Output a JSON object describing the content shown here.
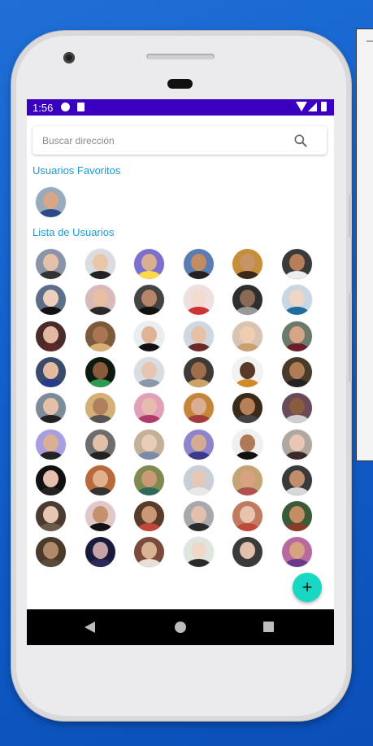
{
  "status_bar": {
    "time": "1:56"
  },
  "search": {
    "placeholder": "Buscar dirección",
    "value": "",
    "icon": "search-icon"
  },
  "favorites": {
    "title": "Usuarios Favoritos",
    "users": [
      {
        "skin": "#d8a787",
        "bg": "#9ab",
        "shirt": "#2b4a8a"
      }
    ]
  },
  "users_list": {
    "title": "Lista de Usuarios",
    "users": [
      {
        "skin": "#e4c2a8",
        "bg": "#8a94a6",
        "shirt": "#333"
      },
      {
        "skin": "#e8c6a6",
        "bg": "#d9dde2",
        "shirt": "#222"
      },
      {
        "skin": "#d9b08f",
        "bg": "#7b6fd0",
        "shirt": "#ffd84a"
      },
      {
        "skin": "#c58d5f",
        "bg": "#5b7cb0",
        "shirt": "#222"
      },
      {
        "skin": "#c79468",
        "bg": "#c48e3a",
        "shirt": "#3a2a1a"
      },
      {
        "skin": "#b57f59",
        "bg": "#3a3a3a",
        "shirt": "#eee"
      },
      {
        "skin": "#ecd0bd",
        "bg": "#5c6f86",
        "shirt": "#111"
      },
      {
        "skin": "#e7bfa3",
        "bg": "#d9b9b9",
        "shirt": "#2a2a2a"
      },
      {
        "skin": "#b5866a",
        "bg": "#444",
        "shirt": "#111"
      },
      {
        "skin": "#f2dccf",
        "bg": "#efe0e0",
        "shirt": "#c33"
      },
      {
        "skin": "#8a6a55",
        "bg": "#2e2e2e",
        "shirt": "#999"
      },
      {
        "skin": "#f0d6c6",
        "bg": "#c9d6e3",
        "shirt": "#1e6d9c"
      },
      {
        "skin": "#e2b8a0",
        "bg": "#4b2a2a",
        "shirt": "#5a2a2a"
      },
      {
        "skin": "#a97552",
        "bg": "#7c5a3c",
        "shirt": "#d6b070"
      },
      {
        "skin": "#e0b296",
        "bg": "#e9eef1",
        "shirt": "#111"
      },
      {
        "skin": "#e6c1a6",
        "bg": "#cfd8e0",
        "shirt": "#6b2a2a"
      },
      {
        "skin": "#f0cdb0",
        "bg": "#d8c4b0",
        "shirt": "#c9a070"
      },
      {
        "skin": "#d6a486",
        "bg": "#6b7a6a",
        "shirt": "#6a1f2a"
      },
      {
        "skin": "#e2bba1",
        "bg": "#3a4a6a",
        "shirt": "#2a3a8a"
      },
      {
        "skin": "#8b5a3c",
        "bg": "#0c1a10",
        "shirt": "#2e9a52"
      },
      {
        "skin": "#e6c6b2",
        "bg": "#d8dde2",
        "shirt": "#8a97a8"
      },
      {
        "skin": "#a06e4b",
        "bg": "#3f3a36",
        "shirt": "#c9a36a"
      },
      {
        "skin": "#5a3a28",
        "bg": "#f2f2f2",
        "shirt": "#d08a2a"
      },
      {
        "skin": "#b07c56",
        "bg": "#4a3a2a",
        "shirt": "#222"
      },
      {
        "skin": "#e4c0a8",
        "bg": "#7c8c9a",
        "shirt": "#222"
      },
      {
        "skin": "#b0805e",
        "bg": "#d4b076",
        "shirt": "#555"
      },
      {
        "skin": "#e6bcb0",
        "bg": "#e2a0b8",
        "shirt": "#b03a6a"
      },
      {
        "skin": "#d9ae94",
        "bg": "#c6863a",
        "shirt": "#a13a3a"
      },
      {
        "skin": "#b88058",
        "bg": "#3a2a1a",
        "shirt": "#444"
      },
      {
        "skin": "#8a5c3e",
        "bg": "#6a4a5a",
        "shirt": "#d0d0d0"
      },
      {
        "skin": "#d9b093",
        "bg": "#a89ee0",
        "shirt": "#222"
      },
      {
        "skin": "#e2bfa7",
        "bg": "#6d6d6d",
        "shirt": "#222"
      },
      {
        "skin": "#e8cdb8",
        "bg": "#c4b096",
        "shirt": "#7a8aa8"
      },
      {
        "skin": "#d4ac92",
        "bg": "#8f83c9",
        "shirt": "#3a3a8a"
      },
      {
        "skin": "#b07a56",
        "bg": "#f0f0f0",
        "shirt": "#111"
      },
      {
        "skin": "#e8c8b4",
        "bg": "#b0a8a0",
        "shirt": "#3a2a2a"
      },
      {
        "skin": "#e6c0ae",
        "bg": "#111111",
        "shirt": "#222"
      },
      {
        "skin": "#e2b08e",
        "bg": "#b86a3a",
        "shirt": "#333"
      },
      {
        "skin": "#c99a74",
        "bg": "#7e8a4e",
        "shirt": "#2e6a5a"
      },
      {
        "skin": "#e6c8b6",
        "bg": "#c9cfd6",
        "shirt": "#e8e8e8"
      },
      {
        "skin": "#d9a283",
        "bg": "#c4a472",
        "shirt": "#b05050"
      },
      {
        "skin": "#c08e6c",
        "bg": "#3a3a3a",
        "shirt": "#d8d8d8"
      },
      {
        "skin": "#e6c6b0",
        "bg": "#4a3a32",
        "shirt": "#6a5a4a"
      },
      {
        "skin": "#c4906e",
        "bg": "#e0c8c8",
        "shirt": "#111"
      },
      {
        "skin": "#c99874",
        "bg": "#5a3a2a",
        "shirt": "#c0463a"
      },
      {
        "skin": "#e2c0ae",
        "bg": "#a8a8ac",
        "shirt": "#2a2a2a"
      },
      {
        "skin": "#e8c4ae",
        "bg": "#c07a60",
        "shirt": "#c04a3a"
      },
      {
        "skin": "#c48e64",
        "bg": "#3a5a3a",
        "shirt": "#8a3a2a"
      },
      {
        "skin": "#b08a6a",
        "bg": "#4a3a2a",
        "shirt": "#5a4a3a"
      },
      {
        "skin": "#c4a4a8",
        "bg": "#1a1a3a",
        "shirt": "#2a2a5a"
      },
      {
        "skin": "#d8b494",
        "bg": "#7a4a3a",
        "shirt": "#e8e0d8"
      },
      {
        "skin": "#efd8c8",
        "bg": "#dfe6e0",
        "shirt": "#2a2a2a"
      },
      {
        "skin": "#e2c0ac",
        "bg": "#3a3a3a",
        "shirt": "#3a3a3a"
      },
      {
        "skin": "#d6a282",
        "bg": "#b86aa0",
        "shirt": "#6a3a8a"
      }
    ]
  },
  "fab": {
    "label": "+"
  }
}
